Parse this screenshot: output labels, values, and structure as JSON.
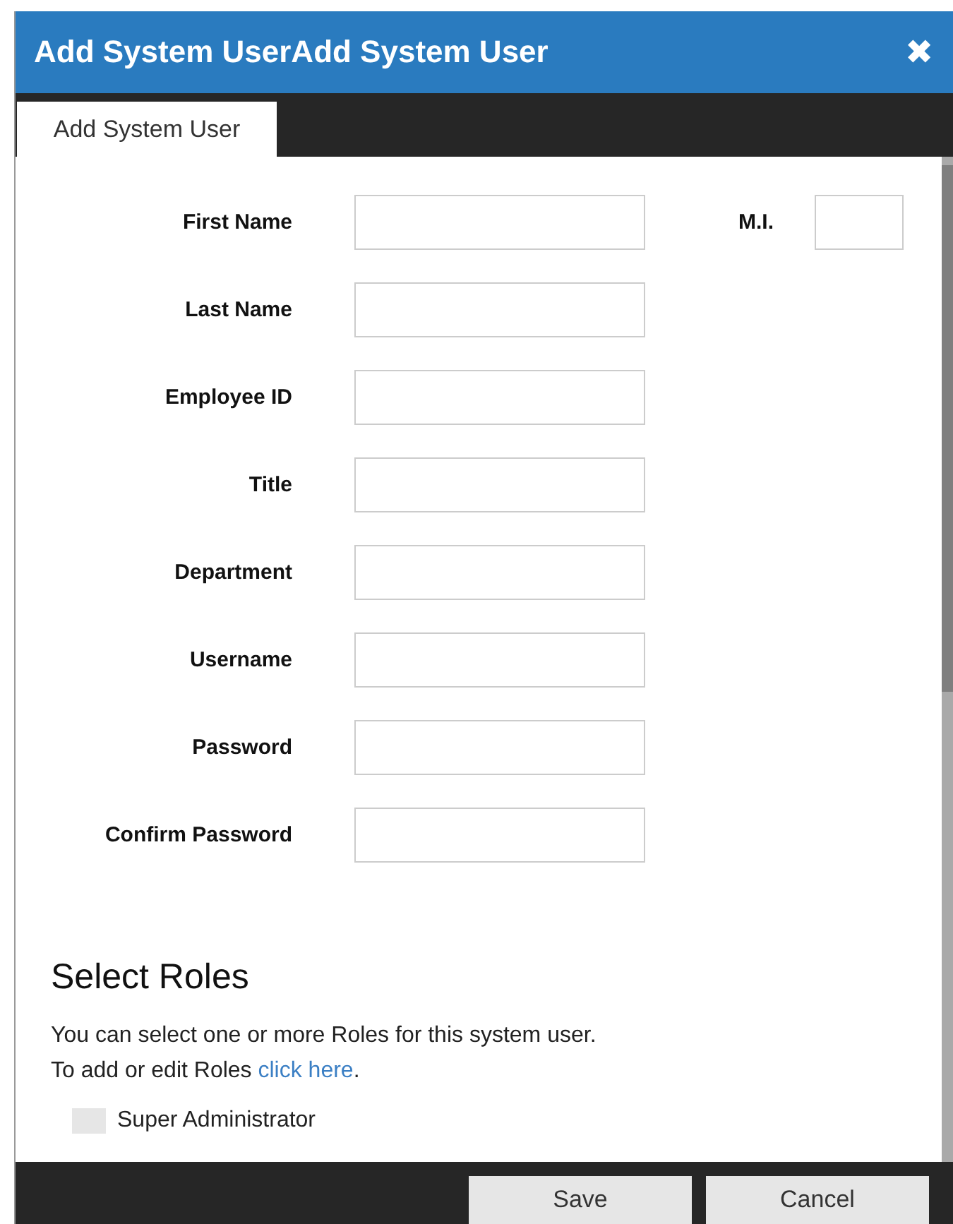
{
  "dialog": {
    "title": "Add System UserAdd System User",
    "close": "✖"
  },
  "tabs": [
    {
      "label": "Add System User",
      "selected": true
    }
  ],
  "fields": [
    {
      "label": "First Name"
    },
    {
      "label": "Last Name"
    },
    {
      "label": "Employee ID"
    },
    {
      "label": "Title"
    },
    {
      "label": "Department"
    },
    {
      "label": "Username"
    },
    {
      "label": "Password"
    },
    {
      "label": "Confirm Password"
    }
  ],
  "middle_initial": {
    "label": "M.I."
  },
  "roles": {
    "heading": "Select Roles",
    "line_1": "You can select one or more Roles for this system user.",
    "line_2": "To add or edit Roles ",
    "link": "click here",
    "link_after": ".",
    "items": [
      {
        "label": "Super Administrator",
        "checked": false
      }
    ]
  },
  "buttons": [
    {
      "label": "Save"
    },
    {
      "label": "Cancel"
    }
  ]
}
